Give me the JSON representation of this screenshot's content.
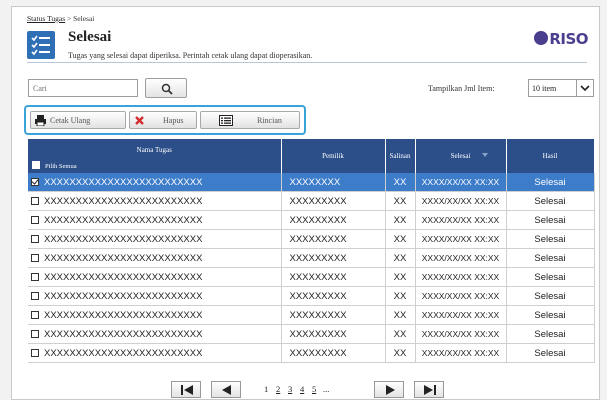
{
  "breadcrumb": {
    "parent": "Status Tugas",
    "separator": " > ",
    "current": "Selesai"
  },
  "header": {
    "title": "Selesai",
    "description": "Tugas yang selesai dapat diperiksa. Perintah cetak ulang dapat dioperasikan.",
    "logo_text": "RISO"
  },
  "search": {
    "placeholder": "Cari"
  },
  "items_control": {
    "label": "Tampilkan Jml Item:",
    "selected": "10 item"
  },
  "toolbar": {
    "reprint_label": "Cetak Ulang",
    "delete_label": "Hapus",
    "details_label": "Rincian"
  },
  "table": {
    "headers": {
      "name": "Nama Tugas",
      "select_all": "Pilih Semua",
      "owner": "Pemilik",
      "copies": "Salinan",
      "finished": "Selesai",
      "result": "Hasil"
    },
    "rows": [
      {
        "checked": true,
        "name": "XXXXXXXXXXXXXXXXXXXXXXXXX",
        "owner": "XXXXXXXX",
        "copies": "XX",
        "finished": "XXXX/XX/XX XX:XX",
        "result": "Selesai"
      },
      {
        "checked": false,
        "name": "XXXXXXXXXXXXXXXXXXXXXXXXX",
        "owner": "XXXXXXXXX",
        "copies": "XX",
        "finished": "XXXX/XX/XX XX:XX",
        "result": "Selesai"
      },
      {
        "checked": false,
        "name": "XXXXXXXXXXXXXXXXXXXXXXXXX",
        "owner": "XXXXXXXXX",
        "copies": "XX",
        "finished": "XXXX/XX/XX XX:XX",
        "result": "Selesai"
      },
      {
        "checked": false,
        "name": "XXXXXXXXXXXXXXXXXXXXXXXXX",
        "owner": "XXXXXXXXX",
        "copies": "XX",
        "finished": "XXXX/XX/XX XX:XX",
        "result": "Selesai"
      },
      {
        "checked": false,
        "name": "XXXXXXXXXXXXXXXXXXXXXXXXX",
        "owner": "XXXXXXXXX",
        "copies": "XX",
        "finished": "XXXX/XX/XX XX:XX",
        "result": "Selesai"
      },
      {
        "checked": false,
        "name": "XXXXXXXXXXXXXXXXXXXXXXXXX",
        "owner": "XXXXXXXXX",
        "copies": "XX",
        "finished": "XXXX/XX/XX XX:XX",
        "result": "Selesai"
      },
      {
        "checked": false,
        "name": "XXXXXXXXXXXXXXXXXXXXXXXXX",
        "owner": "XXXXXXXXX",
        "copies": "XX",
        "finished": "XXXX/XX/XX XX:XX",
        "result": "Selesai"
      },
      {
        "checked": false,
        "name": "XXXXXXXXXXXXXXXXXXXXXXXXX",
        "owner": "XXXXXXXXX",
        "copies": "XX",
        "finished": "XXXX/XX/XX XX:XX",
        "result": "Selesai"
      },
      {
        "checked": false,
        "name": "XXXXXXXXXXXXXXXXXXXXXXXXX",
        "owner": "XXXXXXXXX",
        "copies": "XX",
        "finished": "XXXX/XX/XX XX:XX",
        "result": "Selesai"
      },
      {
        "checked": false,
        "name": "XXXXXXXXXXXXXXXXXXXXXXXXX",
        "owner": "XXXXXXXXX",
        "copies": "XX",
        "finished": "XXXX/XX/XX XX:XX",
        "result": "Selesai"
      }
    ]
  },
  "pagination": {
    "pages": [
      "1",
      "2",
      "3",
      "4",
      "5"
    ],
    "current": "1",
    "ellipsis": "..."
  },
  "colors": {
    "header_blue": "#2c4f8a",
    "selected_row": "#3d7cc9",
    "toolbar_highlight": "#3aa3d8",
    "logo": "#4a3f8f"
  },
  "icons": {
    "title": "checklist-icon",
    "search": "magnifier-icon",
    "reprint": "printer-icon",
    "delete": "red-x-icon",
    "details": "list-details-icon"
  }
}
